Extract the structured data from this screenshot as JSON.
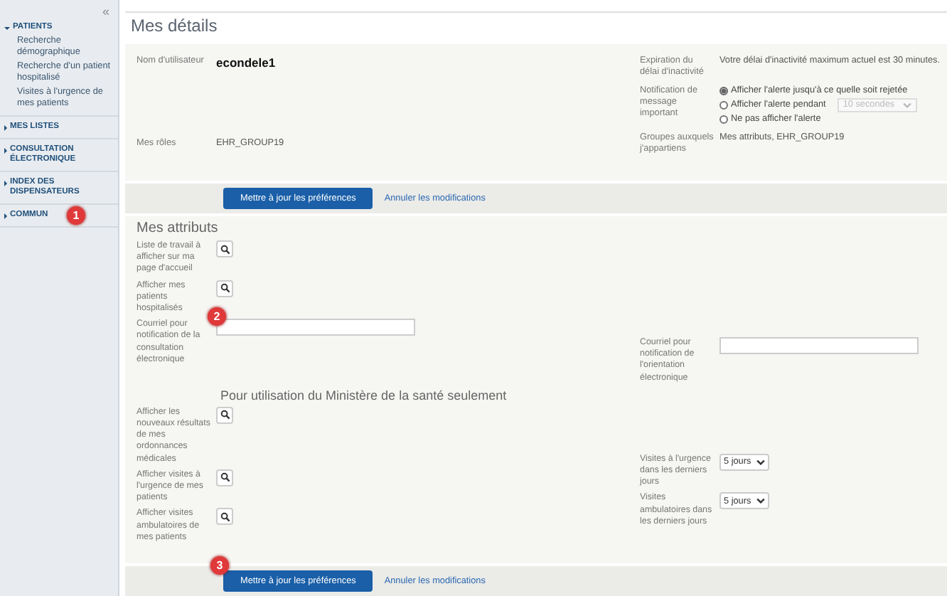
{
  "sidebar": {
    "collapse": "«",
    "sections": [
      {
        "label": "PATIENTS",
        "expanded": true,
        "children": [
          "Recherche démographique",
          "Recherche d'un patient hospitalisé",
          "Visites à l'urgence de mes patients"
        ]
      },
      {
        "label": "MES LISTES",
        "expanded": false
      },
      {
        "label": "CONSULTATION ÉLECTRONIQUE",
        "expanded": false
      },
      {
        "label": "INDEX DES DISPENSATEURS",
        "expanded": false
      },
      {
        "label": "COMMUN",
        "expanded": false,
        "badge": "1"
      }
    ]
  },
  "page_title": "Mes détails",
  "details": {
    "username_label": "Nom d'utilisateur",
    "username": "econdele1",
    "roles_label": "Mes rôles",
    "roles": "EHR_GROUP19",
    "inactivity_label": "Expiration du délai d'inactivité",
    "inactivity": "Votre délai d'inactivité maximum actuel est 30 minutes.",
    "notification_label": "Notification de message important",
    "notification_options": [
      {
        "label": "Afficher l'alerte jusqu'à ce quelle soit rejetée",
        "selected": true
      },
      {
        "label": "Afficher l'alerte pendant",
        "selected": false,
        "select": {
          "value": "10 secondes",
          "disabled": true
        }
      },
      {
        "label": "Ne pas afficher l'alerte",
        "selected": false
      }
    ],
    "groups_label": "Groupes auxquels j'appartiens",
    "groups": "Mes attributs, EHR_GROUP19"
  },
  "action_bars": [
    {
      "primary": "Mettre à jour les préférences",
      "secondary": "Annuler les modifications"
    },
    {
      "primary": "Mettre à jour les préférences",
      "secondary": "Annuler les modifications",
      "badge": "3"
    }
  ],
  "attributes": {
    "title": "Mes attributs",
    "left": [
      {
        "kind": "search",
        "label": "Liste de travail à afficher sur ma page d'accueil"
      },
      {
        "kind": "search",
        "label": "Afficher mes patients hospitalisés"
      },
      {
        "kind": "email",
        "label": "Courriel pour notification de la consultation électronique",
        "badge": "2"
      }
    ],
    "right": [
      {
        "kind": "email",
        "label": "Courriel pour notification de l'orientation électronique"
      }
    ],
    "ministry_title": "Pour utilisation du Ministère de la santé seulement",
    "ministry_left": [
      {
        "kind": "search",
        "label": "Afficher les nouveaux résultats de mes ordonnances médicales"
      },
      {
        "kind": "search",
        "label": "Afficher visites à l'urgence de mes patients"
      },
      {
        "kind": "search",
        "label": "Afficher visites ambulatoires de mes patients"
      }
    ],
    "ministry_right": [
      {
        "kind": "select",
        "label": "Visites à l'urgence dans les derniers jours",
        "value": "5 jours"
      },
      {
        "kind": "select",
        "label": "Visites ambulatoires dans les derniers jours",
        "value": "5 jours"
      }
    ]
  }
}
